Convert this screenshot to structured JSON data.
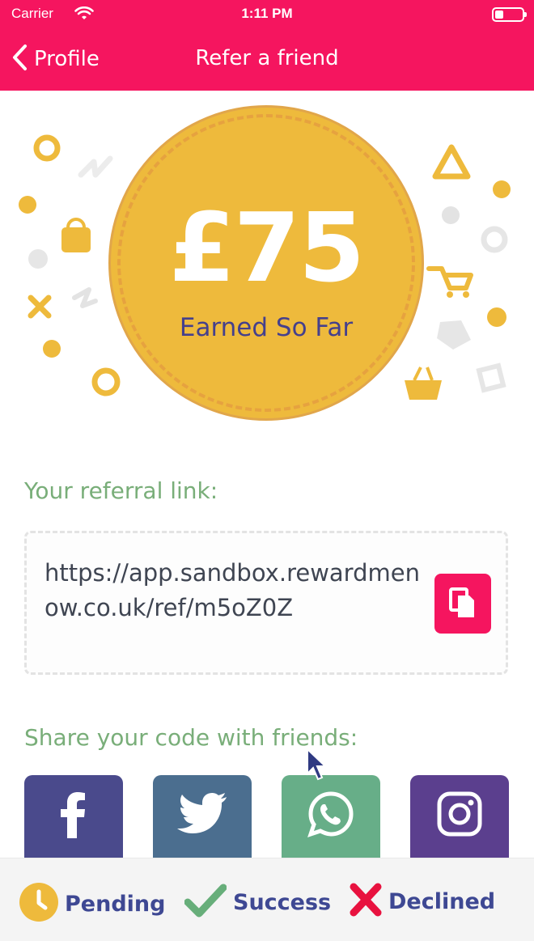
{
  "status_bar": {
    "carrier": "Carrier",
    "time": "1:11 PM"
  },
  "nav": {
    "back_label": "Profile",
    "title": "Refer a friend"
  },
  "earnings": {
    "amount": "£75",
    "label": "Earned So Far"
  },
  "referral": {
    "section_label": "Your referral link:",
    "link": "https://​app.sandbox.rewardmenow.co.uk/ref/m5oZ0Z"
  },
  "share": {
    "section_label": "Share your code with friends:",
    "buttons": [
      {
        "name": "facebook",
        "color": "#4a4a8c"
      },
      {
        "name": "twitter",
        "color": "#4b6e8f"
      },
      {
        "name": "whatsapp",
        "color": "#67ae88"
      },
      {
        "name": "instagram",
        "color": "#5b3f8e"
      }
    ]
  },
  "legend": {
    "pending": "Pending",
    "success": "Success",
    "declined": "Declined"
  },
  "colors": {
    "brand": "#f5155f",
    "coin": "#eeba3c",
    "accent_text": "#79ae79",
    "navy": "#3e4893"
  }
}
